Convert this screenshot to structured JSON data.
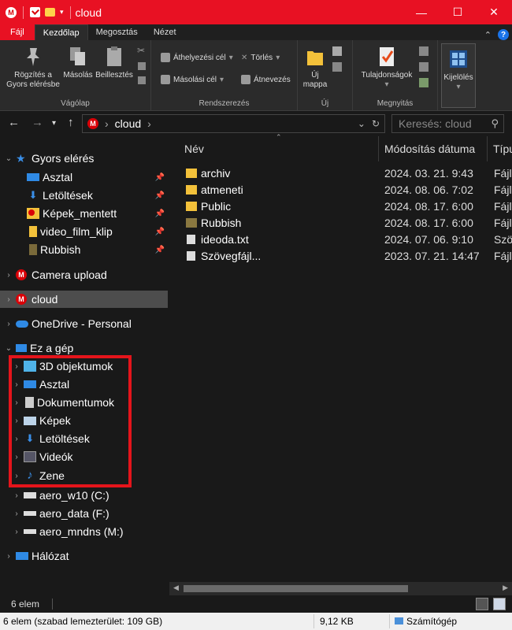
{
  "window": {
    "title": "cloud",
    "controls": {
      "minimize": "—",
      "maximize": "☐",
      "close": "✕"
    }
  },
  "ribbon_tabs": [
    "Fájl",
    "Kezdőlap",
    "Megosztás",
    "Nézet"
  ],
  "ribbon": {
    "groups": {
      "clipboard": "Vágólap",
      "organize": "Rendszerezés",
      "new": "Új",
      "open": "Megnyitás"
    },
    "pin_label_1": "Rögzítés a",
    "pin_label_2": "Gyors elérésbe",
    "copy": "Másolás",
    "paste": "Beillesztés",
    "move_to": "Áthelyezési cél",
    "copy_to": "Másolási cél",
    "delete": "Törlés",
    "rename": "Átnevezés",
    "new_folder_1": "Új",
    "new_folder_2": "mappa",
    "properties": "Tulajdonságok",
    "select": "Kijelölés"
  },
  "address": {
    "path": "cloud",
    "search_placeholder": "Keresés: cloud"
  },
  "nav": {
    "quick_access": "Gyors elérés",
    "quick_items": [
      {
        "label": "Asztal",
        "icon": "desktop-icon"
      },
      {
        "label": "Letöltések",
        "icon": "download-icon"
      },
      {
        "label": "Képek_mentett",
        "icon": "mega-folder-icon"
      },
      {
        "label": "video_film_klip",
        "icon": "folder-icon"
      },
      {
        "label": "Rubbish",
        "icon": "folder-icon"
      }
    ],
    "camera_upload": "Camera upload",
    "cloud": "cloud",
    "onedrive": "OneDrive - Personal",
    "this_pc": "Ez a gép",
    "pc_items": [
      {
        "label": "3D objektumok",
        "icon": "3d-objects-icon"
      },
      {
        "label": "Asztal",
        "icon": "desktop-icon"
      },
      {
        "label": "Dokumentumok",
        "icon": "documents-icon"
      },
      {
        "label": "Képek",
        "icon": "pictures-icon"
      },
      {
        "label": "Letöltések",
        "icon": "download-icon"
      },
      {
        "label": "Videók",
        "icon": "videos-icon"
      },
      {
        "label": "Zene",
        "icon": "music-icon"
      }
    ],
    "drives": [
      {
        "label": "aero_w10 (C:)",
        "icon": "system-drive-icon"
      },
      {
        "label": "aero_data (F:)",
        "icon": "drive-icon"
      },
      {
        "label": "aero_mndns (M:)",
        "icon": "drive-icon"
      }
    ],
    "network": "Hálózat"
  },
  "columns": {
    "name": "Név",
    "date": "Módosítás dátuma",
    "type": "Típu"
  },
  "files": [
    {
      "name": "archiv",
      "date": "2024. 03. 21. 9:43",
      "type": "Fájlm",
      "icon": "folder-sync-icon"
    },
    {
      "name": "atmeneti",
      "date": "2024. 08. 06. 7:02",
      "type": "Fájlm",
      "icon": "folder-sync-icon"
    },
    {
      "name": "Public",
      "date": "2024. 08. 17. 6:00",
      "type": "Fájlm",
      "icon": "folder-sync-icon"
    },
    {
      "name": "Rubbish",
      "date": "2024. 08. 17. 6:00",
      "type": "Fájlm",
      "icon": "folder-icon"
    },
    {
      "name": "ideoda.txt",
      "date": "2024. 07. 06. 9:10",
      "type": "Szöv",
      "icon": "text-file-icon"
    },
    {
      "name": "Szövegfájl...",
      "date": "2023. 07. 21. 14:47",
      "type": "Fájl",
      "icon": "text-file-icon"
    }
  ],
  "status": {
    "item_count": "6 elem",
    "details": "6 elem (szabad lemezterület: 109 GB)",
    "size": "9,12 KB",
    "location": "Számítógép"
  },
  "colors": {
    "title_bar": "#e81123",
    "highlight_box": "#e4141b",
    "folder_yellow": "#f3c13a",
    "selected_nav": "#4d4d4d"
  }
}
